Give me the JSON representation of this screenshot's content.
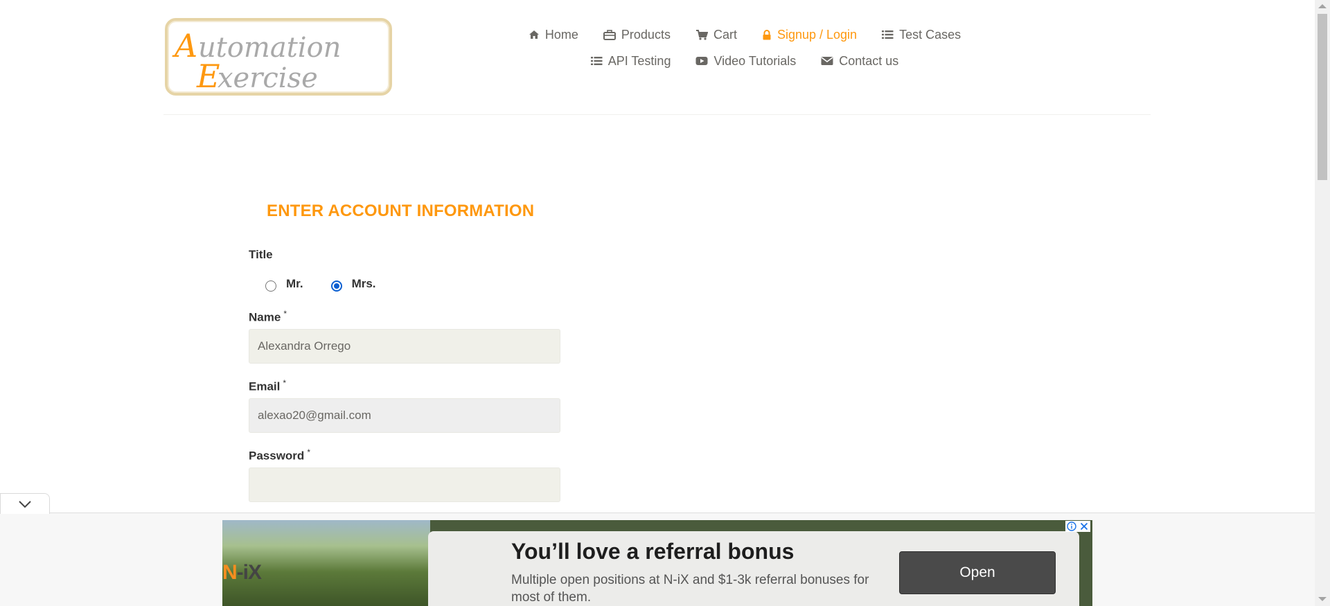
{
  "header": {
    "logo_text": "Automation Exercise",
    "nav": [
      {
        "label": "Home",
        "icon": "home-icon"
      },
      {
        "label": "Products",
        "icon": "briefcase-icon"
      },
      {
        "label": "Cart",
        "icon": "cart-icon"
      },
      {
        "label": "Signup / Login",
        "icon": "lock-icon",
        "active": true
      },
      {
        "label": "Test Cases",
        "icon": "list-icon"
      },
      {
        "label": "API Testing",
        "icon": "list-icon"
      },
      {
        "label": "Video Tutorials",
        "icon": "youtube-play-icon"
      },
      {
        "label": "Contact us",
        "icon": "envelope-icon"
      }
    ]
  },
  "form": {
    "heading": "ENTER ACCOUNT INFORMATION",
    "title_label": "Title",
    "title_options": [
      {
        "label": "Mr.",
        "checked": false
      },
      {
        "label": "Mrs.",
        "checked": true
      }
    ],
    "name_label": "Name",
    "name_value": "Alexandra Orrego",
    "email_label": "Email",
    "email_value": "alexao20@gmail.com",
    "password_label": "Password",
    "password_value": "",
    "required_mark": "*"
  },
  "ad": {
    "brand": "N-iX",
    "headline": "You’ll love a referral bonus",
    "text": "Multiple open positions at N-iX and $1-3k referral bonuses for most of them.",
    "button_label": "Open",
    "info_icon": "info-icon",
    "close_icon": "close-icon"
  },
  "colors": {
    "accent": "#fe980f",
    "nav_text": "#696763",
    "input_bg": "#f0f0e9",
    "radio_checked": "#0b5fd1"
  }
}
